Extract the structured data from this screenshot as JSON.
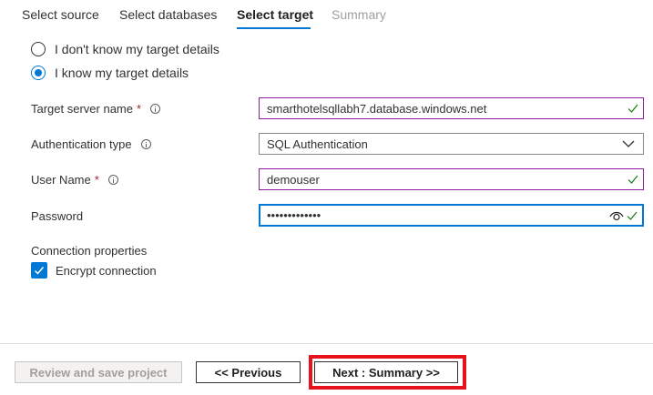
{
  "tabs": [
    {
      "label": "Select source",
      "state": "normal"
    },
    {
      "label": "Select databases",
      "state": "normal"
    },
    {
      "label": "Select target",
      "state": "active"
    },
    {
      "label": "Summary",
      "state": "disabled"
    }
  ],
  "target_options": {
    "unknown_label": "I don't know my target details",
    "known_label": "I know my target details",
    "selected": "known"
  },
  "form": {
    "server": {
      "label": "Target server name",
      "required_mark": "*",
      "value": "smarthotelsqllabh7.database.windows.net"
    },
    "auth": {
      "label": "Authentication type",
      "value": "SQL Authentication"
    },
    "username": {
      "label": "User Name",
      "required_mark": "*",
      "value": "demouser"
    },
    "password": {
      "label": "Password",
      "value_masked": "•••••••••••••"
    }
  },
  "connection": {
    "heading": "Connection properties",
    "encrypt_label": "Encrypt connection",
    "encrypt_checked": true
  },
  "buttons": {
    "review": "Review and save project",
    "previous": "<< Previous",
    "next": "Next : Summary >>"
  },
  "colors": {
    "accent": "#0078d4",
    "valid_border": "#8e1a9e",
    "success_check": "#107c10",
    "highlight": "#e8121c"
  },
  "icons": {
    "info": "info-icon",
    "valid": "checkmark-icon",
    "dropdown": "chevron-down-icon",
    "reveal": "eye-icon"
  }
}
